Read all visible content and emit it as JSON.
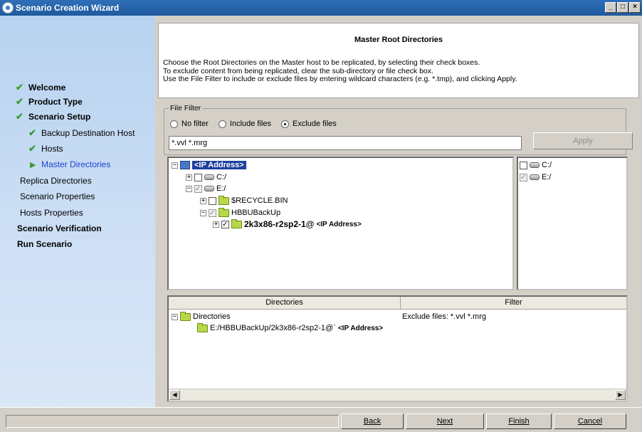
{
  "window": {
    "title": "Scenario Creation Wizard",
    "minimize": "_",
    "maximize": "□",
    "close": "×"
  },
  "sidebar": {
    "steps": [
      {
        "label": "Welcome",
        "state": "done"
      },
      {
        "label": "Product Type",
        "state": "done"
      },
      {
        "label": "Scenario Setup",
        "state": "done"
      },
      {
        "label": "Backup Destination Host",
        "state": "done"
      },
      {
        "label": "Hosts",
        "state": "done"
      },
      {
        "label": "Master Directories",
        "state": "current"
      },
      {
        "label": "Replica Directories",
        "state": "pending"
      },
      {
        "label": "Scenario Properties",
        "state": "pending"
      },
      {
        "label": "Hosts Properties",
        "state": "pending"
      },
      {
        "label": "Scenario Verification",
        "state": "pending"
      },
      {
        "label": "Run Scenario",
        "state": "pending"
      }
    ]
  },
  "header": {
    "title": "Master Root Directories",
    "lines": [
      "Choose the Root Directories on the Master host to be replicated, by selecting their check boxes.",
      "To exclude content from being replicated, clear the sub-directory or file check box.",
      "Use the File Filter to include or exclude files by entering wildcard characters (e.g. *.tmp), and clicking Apply."
    ]
  },
  "file_filter": {
    "legend": "File Filter",
    "options": [
      "No filter",
      "Include files",
      "Exclude files"
    ],
    "selected": "Exclude files",
    "value": "*.vvl *.mrg",
    "apply_label": "Apply"
  },
  "tree": {
    "root": "<IP Address>",
    "drive_c": "C:/",
    "drive_e": "E:/",
    "recycle": "$RECYCLE.BIN",
    "hbbu": "HBBUBackUp",
    "host_folder_name": "2k3x86-r2sp2-1@",
    "host_folder_ip": "<IP Address>"
  },
  "right_drives": [
    "C:/",
    "E:/"
  ],
  "directories_table": {
    "col_directories": "Directories",
    "col_filter": "Filter",
    "root_label": "Directories",
    "path": "E:/HBBUBackUp/2k3x86-r2sp2-1@`",
    "path_ip": "<IP Address>",
    "filter_value": "Exclude files: *.vvl *.mrg"
  },
  "buttons": {
    "back": "Back",
    "next": "Next",
    "finish": "Finish",
    "cancel": "Cancel"
  },
  "colors": {
    "current_step": "#1f3fd6",
    "check": "#3a9a2a",
    "selection": "#1f3f9e"
  }
}
